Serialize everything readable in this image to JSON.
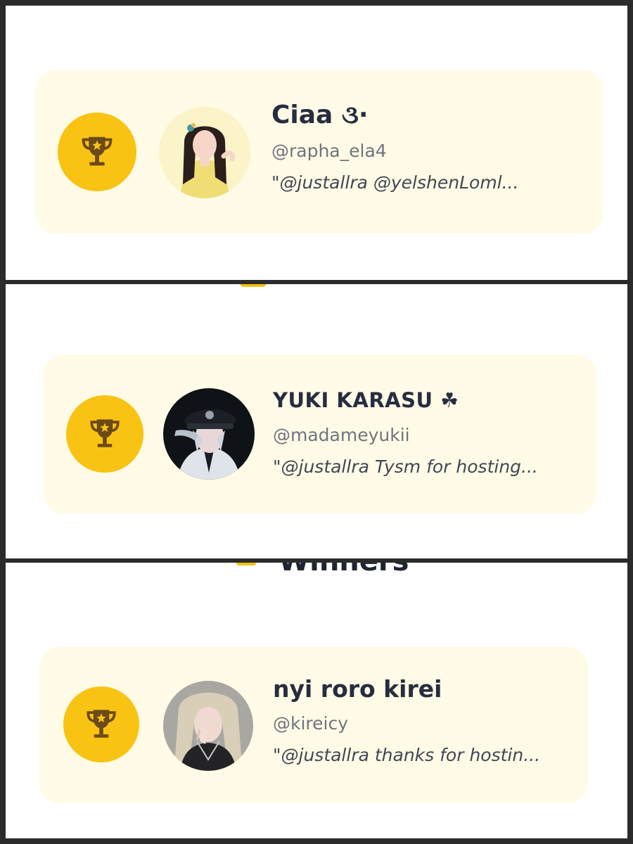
{
  "colors": {
    "card_background": "#fffbe6",
    "badge_yellow": "#f9c313",
    "trophy_brown": "#6b4a1a",
    "name_text": "#262d40",
    "handle_text": "#6f7480"
  },
  "section": {
    "title": "Winners"
  },
  "winners": [
    {
      "name": "Ciaa ૩·",
      "handle": "@rapha_ela4",
      "quote": "\"@justallra @yelshenLoml...",
      "badge_icon": "trophy-icon",
      "avatar_icon": "avatar"
    },
    {
      "name": "YUKI KARASU ☘",
      "handle": "@madameyukii",
      "quote": "\"@justallra Tysm for hosting...",
      "badge_icon": "trophy-icon",
      "avatar_icon": "avatar"
    },
    {
      "name": "nyi roro kirei",
      "handle": "@kireicy",
      "quote": "\"@justallra thanks for hostin...",
      "badge_icon": "trophy-icon",
      "avatar_icon": "avatar"
    }
  ]
}
